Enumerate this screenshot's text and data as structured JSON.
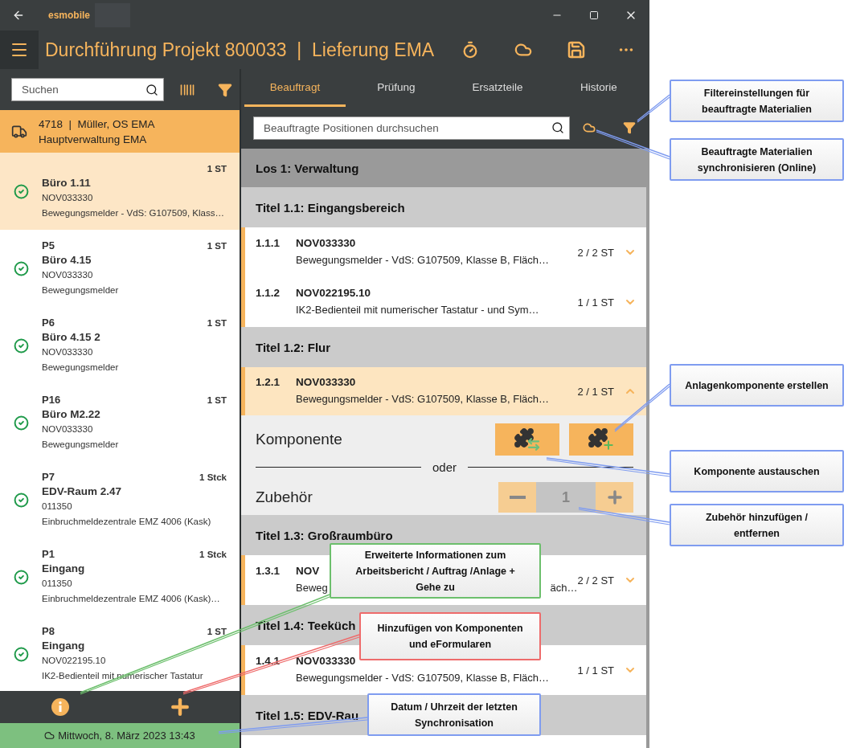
{
  "window": {
    "app_name": "esmobile"
  },
  "header": {
    "title": "Durchführung Projekt 800033  |  Lieferung EMA"
  },
  "left_panel": {
    "search": {
      "placeholder": "Suchen"
    },
    "customer": {
      "line_1": "4718  |  Müller, OS EMA",
      "line_2": "Hauptverwaltung EMA"
    },
    "items": [
      {
        "quantity": "1 ST",
        "room": "Büro 1.11",
        "code": "NOV033330",
        "description": "Bewegungsmelder  -  VdS: G107509, Klass…",
        "selected": true,
        "done": true
      },
      {
        "position": "P5",
        "quantity": "1 ST",
        "room": "Büro 4.15",
        "code": "NOV033330",
        "description": "Bewegungsmelder",
        "selected": false,
        "done": true
      },
      {
        "position": "P6",
        "quantity": "1 ST",
        "room": "Büro 4.15 2",
        "code": "NOV033330",
        "description": "Bewegungsmelder",
        "selected": false,
        "done": true
      },
      {
        "position": "P16",
        "quantity": "1 ST",
        "room": "Büro M2.22",
        "code": "NOV033330",
        "description": "Bewegungsmelder",
        "selected": false,
        "done": true
      },
      {
        "position": "P7",
        "quantity": "1 Stck",
        "room": "EDV-Raum 2.47",
        "code": "011350",
        "description": "Einbruchmeldezentrale EMZ 4006 (Kask)",
        "selected": false,
        "done": true
      },
      {
        "position": "P1",
        "quantity": "1 Stck",
        "room": "Eingang",
        "code": "011350",
        "description": "Einbruchmeldezentrale EMZ 4006 (Kask)…",
        "selected": false,
        "done": true
      },
      {
        "position": "P8",
        "quantity": "1 ST",
        "room": "Eingang",
        "code": "NOV022195.10",
        "description": "IK2-Bedienteil mit numerischer Tastatur",
        "selected": false,
        "done": true
      }
    ],
    "sync_time": "Mittwoch, 8. März 2023 13:43"
  },
  "right_panel": {
    "tabs": [
      {
        "label": "Beauftragt",
        "selected": true
      },
      {
        "label": "Prüfung",
        "selected": false
      },
      {
        "label": "Ersatzteile",
        "selected": false
      },
      {
        "label": "Historie",
        "selected": false
      }
    ],
    "search": {
      "placeholder": "Beauftragte Positionen durchsuchen"
    },
    "sections": [
      {
        "kind": "lot",
        "title": "Los 1: Verwaltung"
      },
      {
        "kind": "title",
        "title": "Titel 1.1: Eingangsbereich",
        "rows": [
          {
            "number": "1.1.1",
            "code": "NOV033330",
            "description": "Bewegungsmelder  -  VdS: G107509, Klasse B, Fläch…",
            "quantity": "2 / 2 ST",
            "expanded": false,
            "selected": false
          },
          {
            "number": "1.1.2",
            "code": "NOV022195.10",
            "description": "IK2-Bedienteil mit numerischer Tastatur  -  und Sym…",
            "quantity": "1 / 1 ST",
            "expanded": false,
            "selected": false
          }
        ]
      },
      {
        "kind": "title",
        "title": "Titel 1.2: Flur",
        "rows": [
          {
            "number": "1.2.1",
            "code": "NOV033330",
            "description": "Bewegungsmelder  -  VdS: G107509, Klasse B, Fläch…",
            "quantity": "2 / 1 ST",
            "expanded": true,
            "selected": true,
            "detail": {
              "component_label": "Komponente",
              "or_label": "oder",
              "accessory_label": "Zubehör",
              "accessory_count": "1"
            }
          }
        ]
      },
      {
        "kind": "title",
        "title": "Titel 1.3: Großraumbüro",
        "rows": [
          {
            "number": "1.3.1",
            "code": "NOV",
            "description": "Beweg",
            "tail": "äch…",
            "quantity": "2 / 2 ST",
            "expanded": false,
            "selected": false
          }
        ]
      },
      {
        "kind": "title",
        "title": "Titel 1.4: Teeküch",
        "rows": [
          {
            "number": "1.4.1",
            "code": "NOV033330",
            "description": "Bewegungsmelder  -  VdS: G107509, Klasse B, Fläch…",
            "quantity": "1 / 1 ST",
            "expanded": false,
            "selected": false
          }
        ]
      },
      {
        "kind": "title",
        "title": "Titel 1.5: EDV-Rau"
      }
    ]
  },
  "annotations": [
    {
      "text": "Filtereinstellungen für beauftragte Materialien",
      "color": "#7f9cf0"
    },
    {
      "text": "Beauftragte Materialien synchronisieren (Online)",
      "color": "#7f9cf0"
    },
    {
      "text": "Anlagenkomponente erstellen",
      "color": "#7f9cf0"
    },
    {
      "text": "Komponente austauschen",
      "color": "#7f9cf0"
    },
    {
      "text": "Zubehör hinzufügen / entfernen",
      "color": "#7f9cf0"
    },
    {
      "text": "Erweiterte Informationen zum Arbeitsbericht / Auftrag /Anlage + Gehe zu",
      "color": "#6cbf6c"
    },
    {
      "text": "Hinzufügen von Komponenten und eFormularen",
      "color": "#ee6b6b"
    },
    {
      "text": "Datum / Uhrzeit der letzten Synchronisation",
      "color": "#7f9cf0"
    }
  ]
}
